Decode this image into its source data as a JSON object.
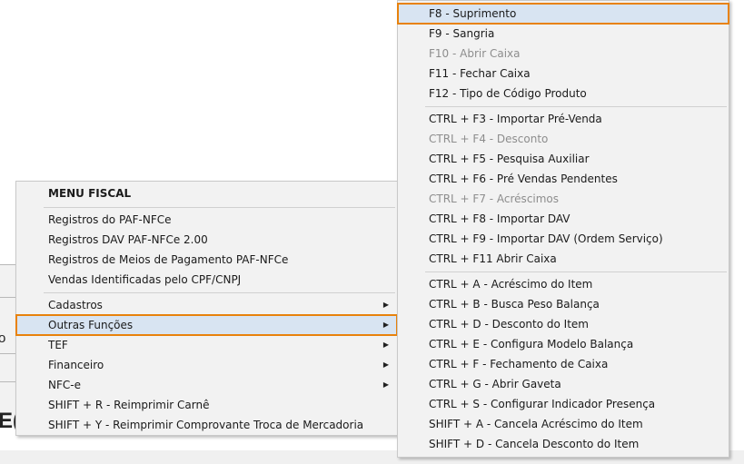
{
  "background": {
    "fragments": [
      "o",
      "E("
    ]
  },
  "main_menu": {
    "header": "MENU FISCAL",
    "group1": [
      {
        "label": "Registros do PAF-NFCe"
      },
      {
        "label": "Registros DAV PAF-NFCe 2.00"
      },
      {
        "label": "Registros de Meios de Pagamento PAF-NFCe"
      },
      {
        "label": "Vendas Identificadas pelo CPF/CNPJ"
      }
    ],
    "group2": [
      {
        "label": "Cadastros",
        "submenu": true,
        "arrow": "▶"
      },
      {
        "label": "Outras Funções",
        "submenu": true,
        "arrow": "▶",
        "highlighted": true
      },
      {
        "label": "TEF",
        "submenu": true,
        "arrow": "▶"
      },
      {
        "label": "Financeiro",
        "submenu": true,
        "arrow": "▶"
      },
      {
        "label": "NFC-e",
        "submenu": true,
        "arrow": "▶"
      },
      {
        "label": "SHIFT + R - Reimprimir Carnê"
      },
      {
        "label": "SHIFT + Y - Reimprimir Comprovante Troca de Mercadoria"
      }
    ]
  },
  "sub_menu": {
    "group1": [
      {
        "label": "F8 - Suprimento",
        "highlighted": true
      },
      {
        "label": "F9 - Sangria"
      },
      {
        "label": "F10 - Abrir Caixa",
        "disabled": true
      },
      {
        "label": "F11 - Fechar Caixa"
      },
      {
        "label": "F12 - Tipo de Código Produto"
      }
    ],
    "group2": [
      {
        "label": "CTRL + F3 - Importar Pré-Venda"
      },
      {
        "label": "CTRL + F4 - Desconto",
        "disabled": true
      },
      {
        "label": "CTRL + F5 - Pesquisa Auxiliar"
      },
      {
        "label": "CTRL + F6 - Pré Vendas Pendentes"
      },
      {
        "label": "CTRL + F7 - Acréscimos",
        "disabled": true
      },
      {
        "label": "CTRL + F8 - Importar DAV"
      },
      {
        "label": "CTRL + F9 - Importar DAV (Ordem Serviço)"
      },
      {
        "label": "CTRL + F11 Abrir Caixa"
      }
    ],
    "group3": [
      {
        "label": "CTRL + A - Acréscimo do Item"
      },
      {
        "label": "CTRL + B - Busca Peso Balança"
      },
      {
        "label": "CTRL + D - Desconto do Item"
      },
      {
        "label": "CTRL + E - Configura Modelo Balança"
      },
      {
        "label": "CTRL + F - Fechamento de Caixa"
      },
      {
        "label": "CTRL + G - Abrir Gaveta"
      },
      {
        "label": "CTRL + S - Configurar Indicador Presença"
      },
      {
        "label": "SHIFT + A - Cancela Acréscimo do Item"
      },
      {
        "label": "SHIFT + D - Cancela Desconto do Item"
      }
    ]
  },
  "colors": {
    "menu_bg": "#f2f2f2",
    "highlight_bg": "#d8e4f2",
    "highlight_border": "#e8820c",
    "disabled_text": "#8d8d8d"
  }
}
